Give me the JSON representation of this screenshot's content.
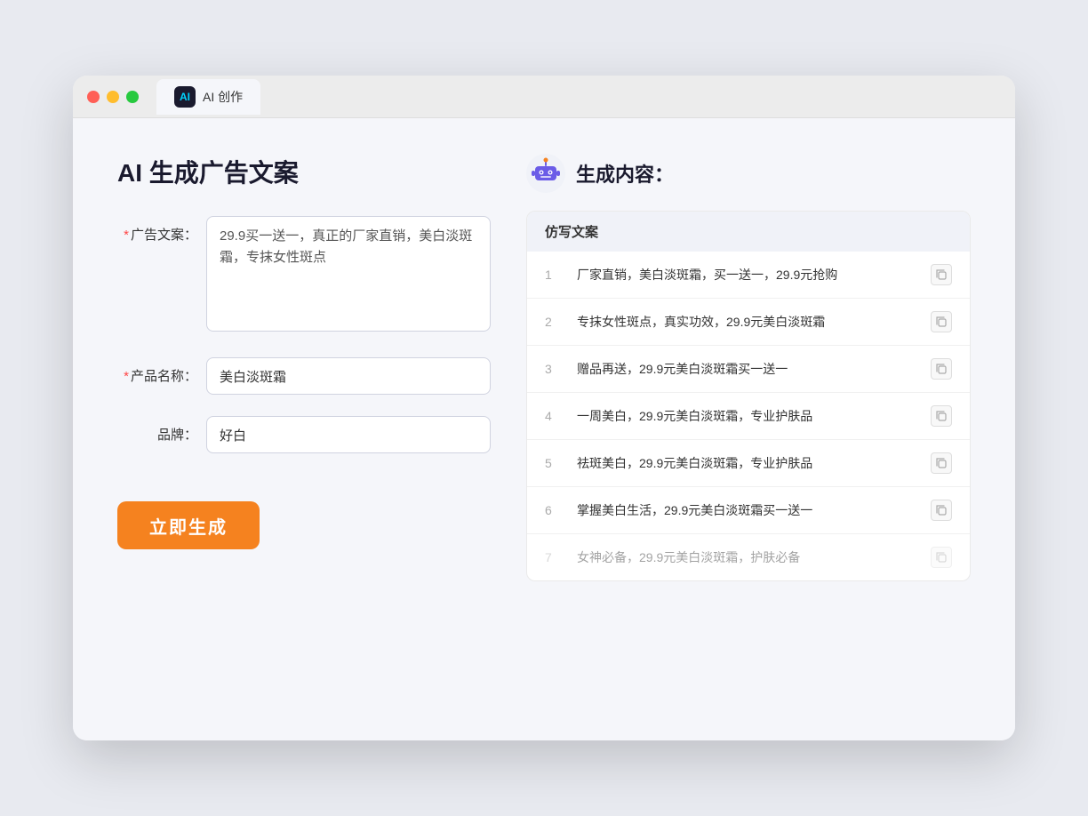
{
  "browser": {
    "tab_label": "AI 创作",
    "ai_icon_text": "AI"
  },
  "left": {
    "page_title": "AI 生成广告文案",
    "form": {
      "ad_copy_label": "广告文案：",
      "ad_copy_required": "*",
      "ad_copy_value": "29.9买一送一，真正的厂家直销，美白淡斑霜，专抹女性斑点",
      "product_name_label": "产品名称：",
      "product_name_required": "*",
      "product_name_value": "美白淡斑霜",
      "brand_label": "品牌：",
      "brand_value": "好白"
    },
    "generate_btn": "立即生成"
  },
  "right": {
    "title": "生成内容：",
    "table_header": "仿写文案",
    "results": [
      {
        "num": "1",
        "text": "厂家直销，美白淡斑霜，买一送一，29.9元抢购",
        "dimmed": false
      },
      {
        "num": "2",
        "text": "专抹女性斑点，真实功效，29.9元美白淡斑霜",
        "dimmed": false
      },
      {
        "num": "3",
        "text": "赠品再送，29.9元美白淡斑霜买一送一",
        "dimmed": false
      },
      {
        "num": "4",
        "text": "一周美白，29.9元美白淡斑霜，专业护肤品",
        "dimmed": false
      },
      {
        "num": "5",
        "text": "祛斑美白，29.9元美白淡斑霜，专业护肤品",
        "dimmed": false
      },
      {
        "num": "6",
        "text": "掌握美白生活，29.9元美白淡斑霜买一送一",
        "dimmed": false
      },
      {
        "num": "7",
        "text": "女神必备，29.9元美白淡斑霜，护肤必备",
        "dimmed": true
      }
    ]
  }
}
